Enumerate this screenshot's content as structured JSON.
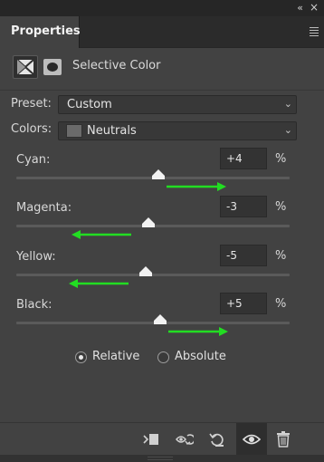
{
  "panel": {
    "tab_label": "Properties",
    "adjustment_title": "Selective Color"
  },
  "preset": {
    "label": "Preset:",
    "value": "Custom"
  },
  "colors": {
    "label": "Colors:",
    "value": "Neutrals"
  },
  "sliders": [
    {
      "label": "Cyan:",
      "value": "+4",
      "unit": "%",
      "level": 0.52,
      "direction": "right"
    },
    {
      "label": "Magenta:",
      "value": "-3",
      "unit": "%",
      "level": 0.485,
      "direction": "left"
    },
    {
      "label": "Yellow:",
      "value": "-5",
      "unit": "%",
      "level": 0.475,
      "direction": "left"
    },
    {
      "label": "Black:",
      "value": "+5",
      "unit": "%",
      "level": 0.525,
      "direction": "right"
    }
  ],
  "method": {
    "options": [
      "Relative",
      "Absolute"
    ],
    "selected": "Relative"
  },
  "colors_palette": {
    "arrow": "#22dd22",
    "panel_bg": "#424242",
    "track": "#5a5a5a"
  },
  "icons": [
    "collapse-icon",
    "close-icon",
    "panel-menu-icon",
    "adjustment-icon",
    "mask-icon",
    "clip-to-layer-icon",
    "view-previous-icon",
    "reset-icon",
    "visibility-icon",
    "delete-icon"
  ]
}
